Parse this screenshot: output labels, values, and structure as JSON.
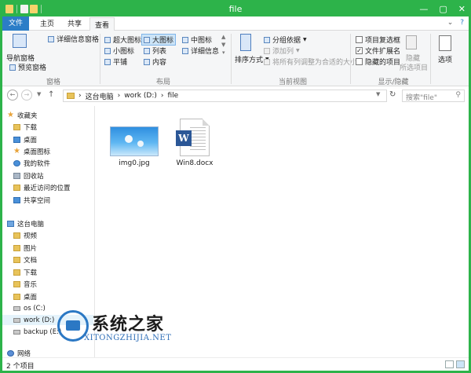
{
  "window": {
    "title": "file",
    "minimize": "—",
    "maximize": "▢",
    "close": "✕"
  },
  "tabs": {
    "file": "文件",
    "home": "主页",
    "share": "共享",
    "view": "查看"
  },
  "ribbon": {
    "pane": {
      "nav_pane": "导航窗格",
      "preview_pane": "预览窗格",
      "details_pane": "详细信息窗格",
      "group": "窗格"
    },
    "layout": {
      "items": [
        "超大图标",
        "大图标",
        "中图标",
        "小图标",
        "列表",
        "详细信息",
        "平铺",
        "内容"
      ],
      "selected": "大图标",
      "group": "布局"
    },
    "current_view": {
      "sort_by": "排序方式",
      "group_by": "分组依据",
      "add_columns": "添加列",
      "size_all": "将所有列调整为合适的大小",
      "group": "当前视图"
    },
    "show_hide": {
      "item_checkboxes": "项目复选框",
      "file_extensions": "文件扩展名",
      "hidden_items": "隐藏的项目",
      "hide": "隐藏",
      "selected_items": "所选项目",
      "group": "显示/隐藏"
    },
    "options": "选项"
  },
  "address": {
    "path": [
      "这台电脑",
      "work (D:)",
      "file"
    ],
    "search_placeholder": "搜索\"file\""
  },
  "nav": {
    "favorites": "收藏夹",
    "fav_items": [
      "下载",
      "桌面",
      "桌面图标",
      "我的软件",
      "回收站",
      "最近访问的位置",
      "共享空间"
    ],
    "this_pc": "这台电脑",
    "pc_items": [
      "视频",
      "图片",
      "文档",
      "下载",
      "音乐",
      "桌面",
      "os (C:)",
      "work (D:)",
      "backup (E:)"
    ],
    "network": "网络"
  },
  "files": [
    {
      "name": "img0.jpg",
      "type": "image"
    },
    {
      "name": "Win8.docx",
      "type": "word"
    }
  ],
  "status": {
    "count": "2 个项目"
  },
  "watermark": {
    "title": "系统之家",
    "site": "XITONGZHIJIA.NET"
  },
  "colors": {
    "title_bar": "#2db34a",
    "file_tab": "#2b7dc7",
    "word": "#2b5797"
  }
}
